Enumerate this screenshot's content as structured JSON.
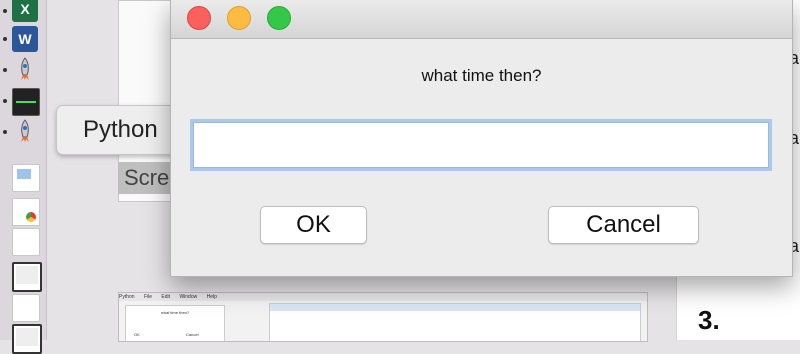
{
  "dialog": {
    "prompt": "what time then?",
    "input_value": "",
    "ok_label": "OK",
    "cancel_label": "Cancel"
  },
  "dock": {
    "tooltip": "Python",
    "partial_label": "Scre",
    "excel_letter": "X",
    "word_letter": "W"
  },
  "background": {
    "right_letters": [
      "a",
      "a",
      "a"
    ],
    "heading_number": "3."
  },
  "thumbnail": {
    "menu": [
      "Python",
      "File",
      "Edit",
      "Window",
      "Help"
    ],
    "dialog_prompt": "what time then?",
    "dialog_ok": "OK",
    "dialog_cancel": "Cancel"
  },
  "colors": {
    "close": "#fc605c",
    "minimize": "#fdbc40",
    "maximize": "#34c84a",
    "focus_ring": "#a9c9f0"
  }
}
